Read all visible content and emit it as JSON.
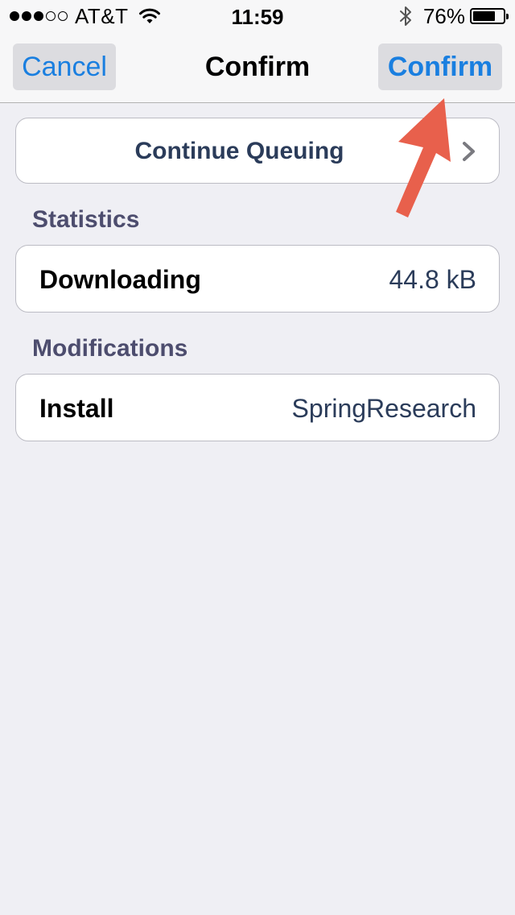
{
  "status_bar": {
    "carrier": "AT&T",
    "time": "11:59",
    "battery_percent": "76%",
    "battery_level": 0.76,
    "signal_bars_filled": 3,
    "signal_bars_total": 5,
    "icons": [
      "wifi-icon",
      "bluetooth-icon",
      "battery-icon"
    ]
  },
  "nav": {
    "cancel_label": "Cancel",
    "title": "Confirm",
    "confirm_label": "Confirm"
  },
  "queue": {
    "label": "Continue Queuing",
    "icon": "chevron-right-icon"
  },
  "statistics": {
    "section_title": "Statistics",
    "row_label": "Downloading",
    "row_value": "44.8 kB"
  },
  "modifications": {
    "section_title": "Modifications",
    "row_label": "Install",
    "row_value": "SpringResearch"
  },
  "annotation": {
    "icon": "arrow-annotation-icon",
    "color": "#e8604c"
  },
  "colors": {
    "accent": "#1a7fe0",
    "background": "#efeff4",
    "section_title": "#4d4d6e",
    "value_text": "#2b3c5a"
  }
}
